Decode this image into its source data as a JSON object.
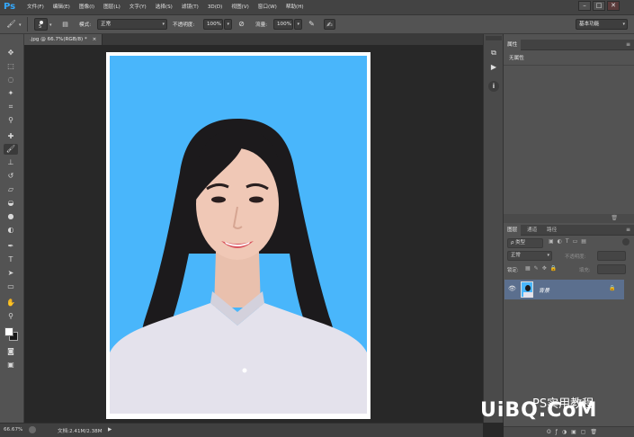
{
  "app": {
    "logo": "Ps"
  },
  "menu": [
    "文件(F)",
    "编辑(E)",
    "图像(I)",
    "图层(L)",
    "文字(Y)",
    "选择(S)",
    "滤镜(T)",
    "3D(D)",
    "视图(V)",
    "窗口(W)",
    "帮助(H)"
  ],
  "window_controls": {
    "minimize": "–",
    "restore": "□",
    "close": "✕"
  },
  "options": {
    "brush_size": "5",
    "mode_label": "模式:",
    "mode_value": "正常",
    "opacity_label": "不透明度:",
    "opacity_value": "100%",
    "flow_label": "流量:",
    "flow_value": "100%",
    "workspace": "基本功能"
  },
  "document": {
    "tab_title": ".jpg @ 66.7%(RGB/8) *",
    "tab_close": "×"
  },
  "status": {
    "zoom": "66.67%",
    "doc_info": "文档:2.41M/2.38M"
  },
  "properties_panel": {
    "tab": "属性",
    "content": "无属性"
  },
  "layers_panel": {
    "tabs": [
      "图层",
      "通道",
      "路径"
    ],
    "filter_kind": "ρ 类型",
    "blend_mode": "正常",
    "opacity_label": "不透明度:",
    "lock_label": "锁定:",
    "fill_label": "填充:",
    "layer_name": "背景"
  },
  "watermark": {
    "text_cn": "PS实用教程",
    "text_en": "UiBQ.CoM"
  },
  "colors": {
    "photo_background": "#49b6fb",
    "selected_layer": "#5b6f8e",
    "ps_blue": "#34a9ff"
  }
}
